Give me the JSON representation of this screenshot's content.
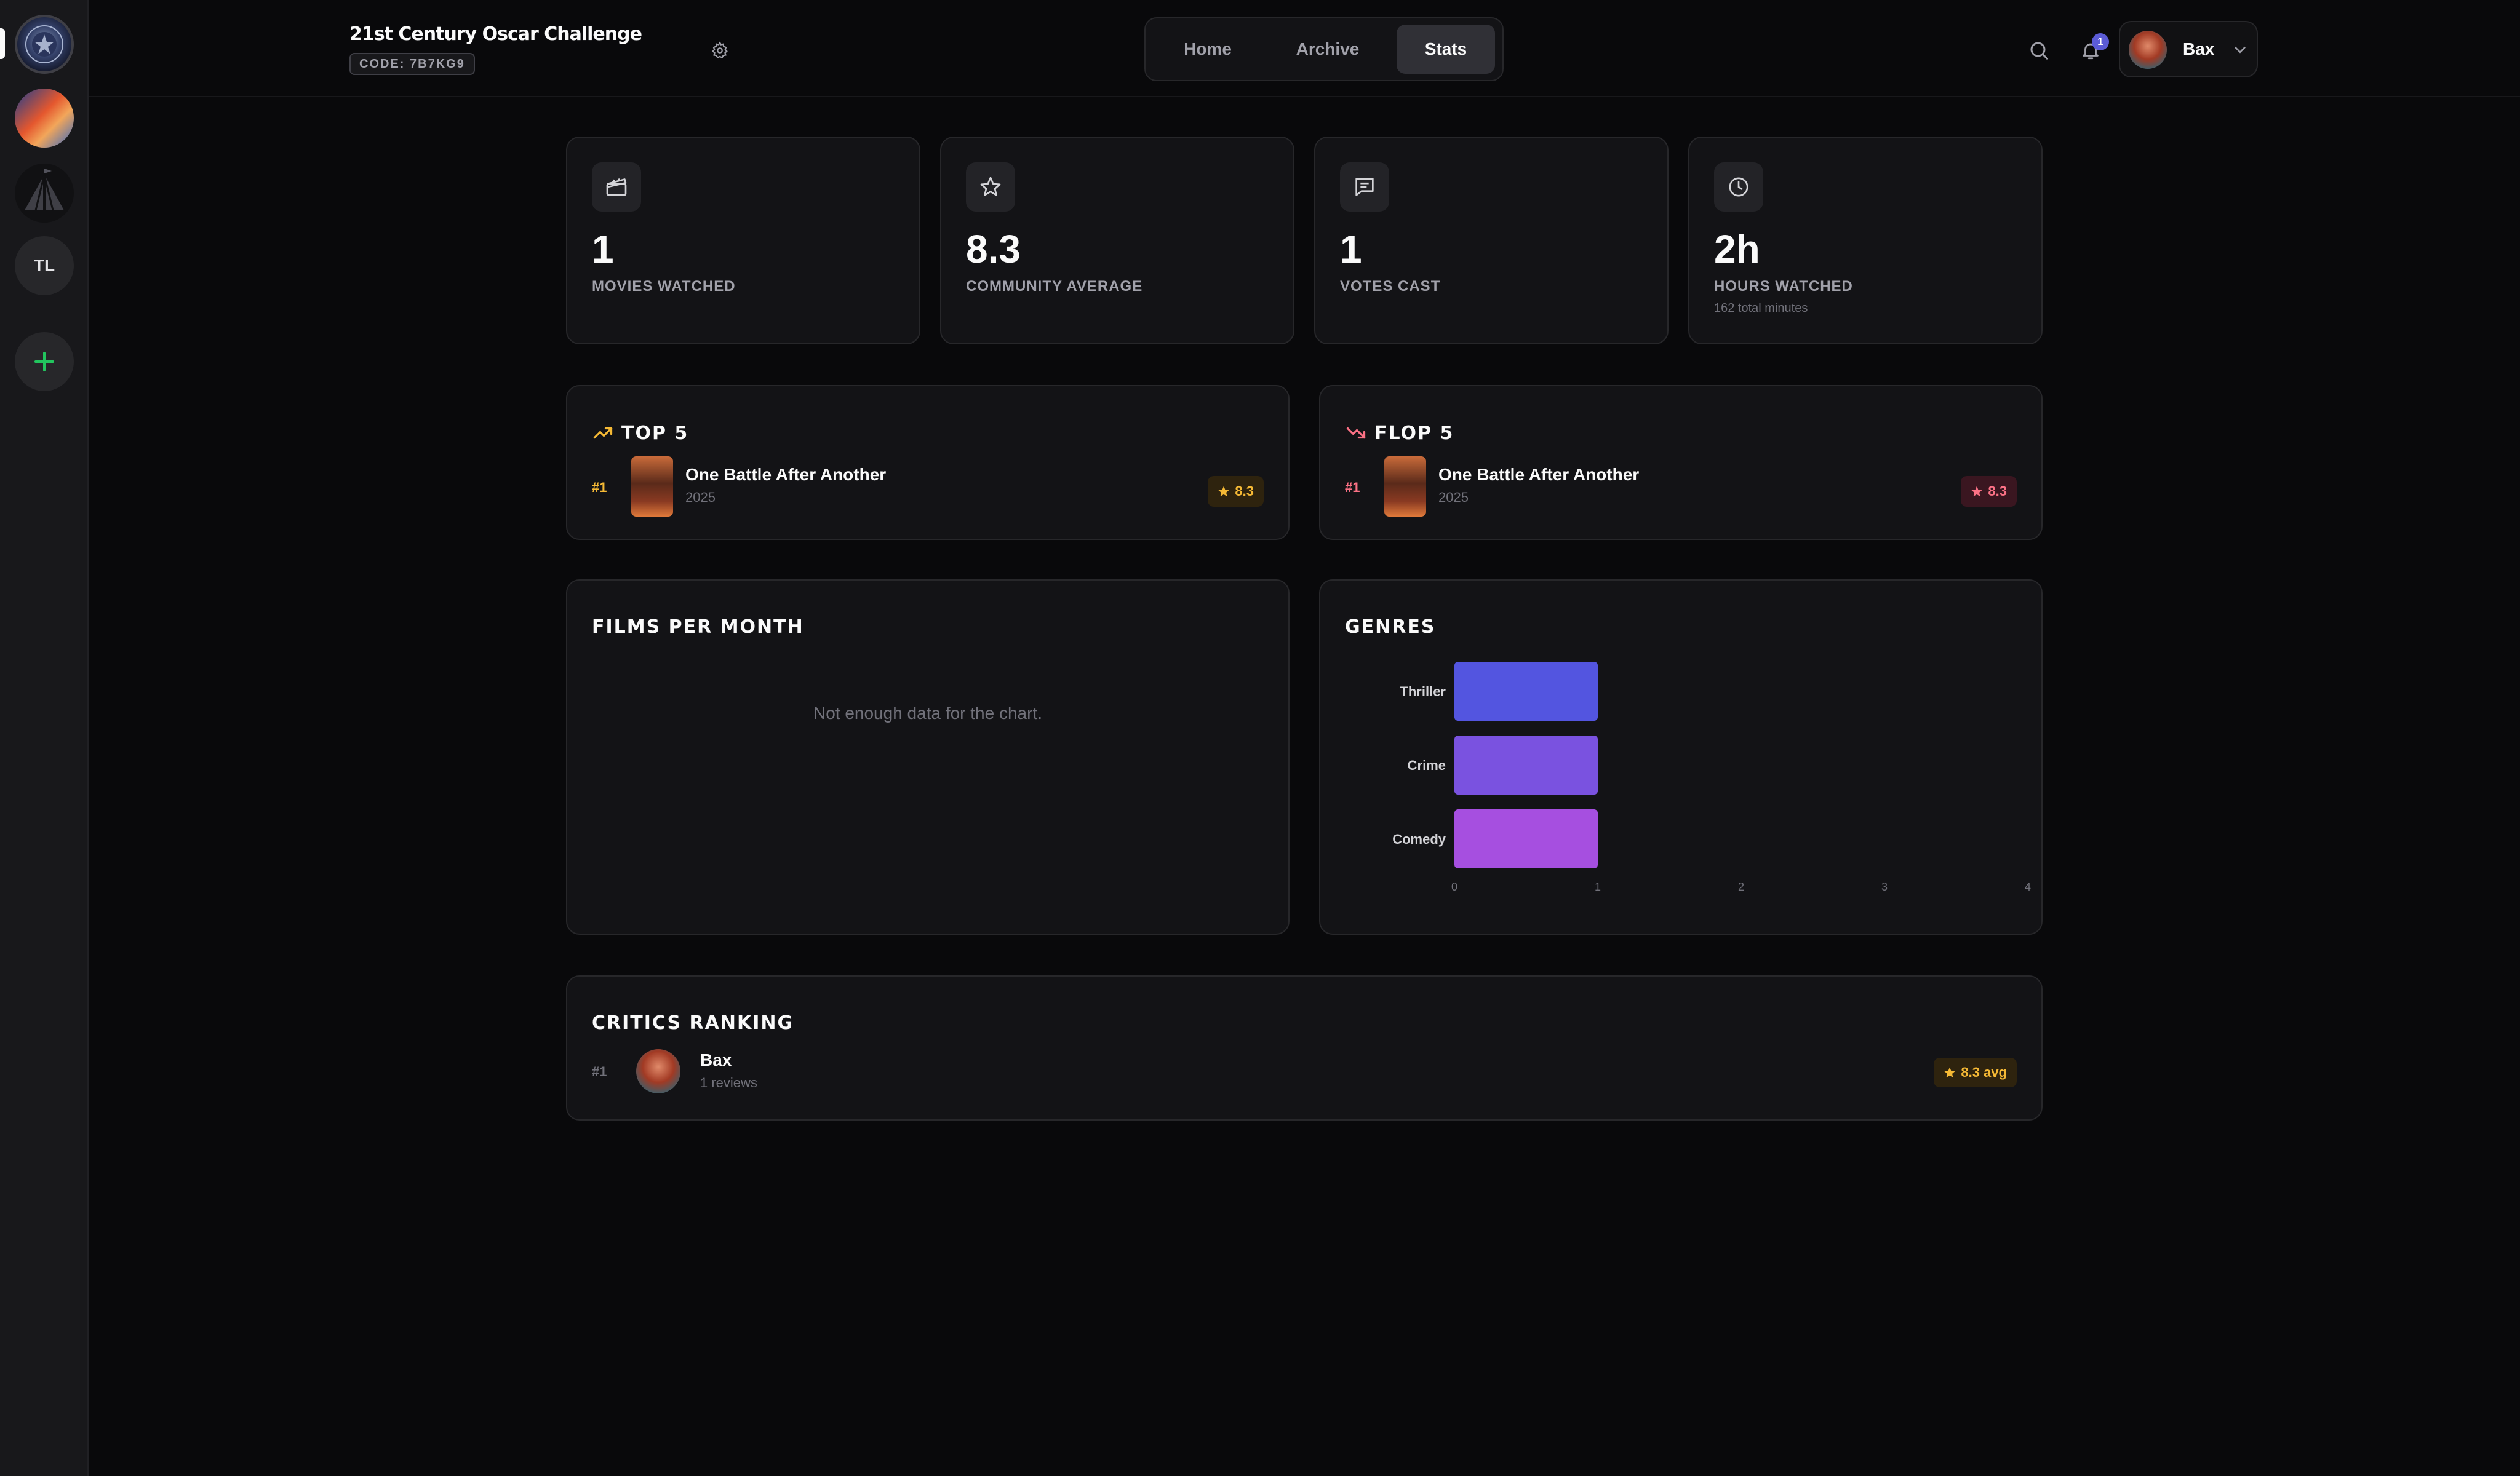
{
  "sidebar": {
    "groups": [
      {
        "name": "oscar-group-avatar"
      },
      {
        "name": "group-avatar-2"
      },
      {
        "name": "group-avatar-3"
      },
      {
        "initials": "TL"
      }
    ],
    "add_icon": "plus-icon"
  },
  "header": {
    "title": "21st Century Oscar Challenge",
    "code": "CODE: 7B7KG9",
    "tabs": [
      {
        "label": "Home"
      },
      {
        "label": "Archive"
      },
      {
        "label": "Stats"
      }
    ],
    "active_tab": "Stats",
    "notifications_count": "1",
    "user_name": "Bax"
  },
  "stats": [
    {
      "icon": "clapperboard-icon",
      "value": "1",
      "label": "MOVIES WATCHED",
      "sub": ""
    },
    {
      "icon": "star-icon",
      "value": "8.3",
      "label": "COMMUNITY AVERAGE",
      "sub": ""
    },
    {
      "icon": "message-icon",
      "value": "1",
      "label": "VOTES CAST",
      "sub": ""
    },
    {
      "icon": "clock-icon",
      "value": "2h",
      "label": "HOURS WATCHED",
      "sub": "162 total minutes"
    }
  ],
  "top5": {
    "title": "TOP 5",
    "items": [
      {
        "rank": "#1",
        "title": "One Battle After Another",
        "year": "2025",
        "rating": "8.3"
      }
    ]
  },
  "flop5": {
    "title": "FLOP 5",
    "items": [
      {
        "rank": "#1",
        "title": "One Battle After Another",
        "year": "2025",
        "rating": "8.3"
      }
    ]
  },
  "films_per_month": {
    "title": "FILMS PER MONTH",
    "empty": "Not enough data for the chart."
  },
  "genres": {
    "title": "GENRES"
  },
  "chart_data": {
    "type": "bar",
    "orientation": "horizontal",
    "title": "GENRES",
    "categories": [
      "Thriller",
      "Crime",
      "Comedy"
    ],
    "values": [
      1,
      1,
      1
    ],
    "xlim": [
      0,
      4
    ],
    "x_ticks": [
      "0",
      "1",
      "2",
      "3",
      "4"
    ],
    "colors": [
      "#5355e0",
      "#7a52e0",
      "#a64fe0"
    ],
    "grid": false
  },
  "critics": {
    "title": "CRITICS RANKING",
    "items": [
      {
        "rank": "#1",
        "name": "Bax",
        "reviews": "1 reviews",
        "avg": "8.3 avg"
      }
    ]
  },
  "colors": {
    "background": "#09090b",
    "card": "#131316",
    "accent_gold": "#f5b935",
    "accent_red": "#fb7185",
    "notification": "#5b5bd6",
    "add_green": "#22c55e"
  }
}
